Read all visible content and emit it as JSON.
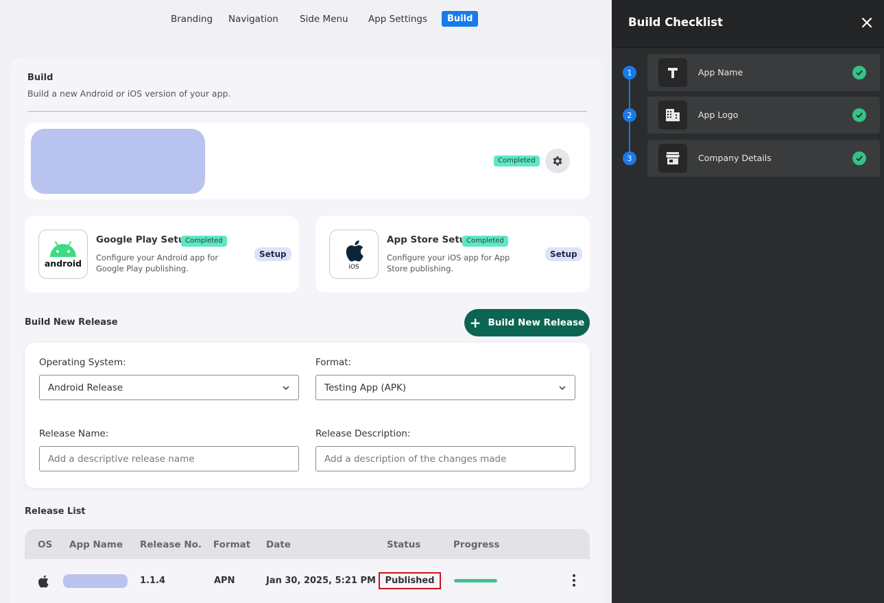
{
  "tabs": [
    {
      "label": "Branding",
      "active": false
    },
    {
      "label": "Navigation",
      "active": false
    },
    {
      "label": "Side Menu",
      "active": false
    },
    {
      "label": "App Settings",
      "active": false
    },
    {
      "label": "Build",
      "active": true
    }
  ],
  "build": {
    "title": "Build",
    "subtitle": "Build a new Android or iOS version of your app.",
    "app_status": "Completed"
  },
  "stores": {
    "google": {
      "icon_label": "android",
      "title": "Google Play Setup",
      "status": "Completed",
      "description": "Configure your Android app for Google Play publishing.",
      "setup_label": "Setup"
    },
    "apple": {
      "icon_label": "iOS",
      "title": "App Store Setup",
      "status": "Completed",
      "description": "Configure your iOS app for App Store publishing.",
      "setup_label": "Setup"
    }
  },
  "new_release": {
    "title": "Build New Release",
    "button_label": "Build New Release",
    "os_label": "Operating System:",
    "os_value": "Android Release",
    "format_label": "Format:",
    "format_value": "Testing App (APK)",
    "name_label": "Release Name:",
    "name_placeholder": "Add a descriptive release name",
    "desc_label": "Release Description:",
    "desc_placeholder": "Add a description of the changes made"
  },
  "release_list": {
    "title": "Release List",
    "columns": [
      "OS",
      "App Name",
      "Release No.",
      "Format",
      "Date",
      "Status",
      "Progress"
    ],
    "rows": [
      {
        "os_icon": "apple-icon",
        "release_no": "1.1.4",
        "format": "APN",
        "date": "Jan 30, 2025, 5:21 PM",
        "status": "Published",
        "progress": 1.0
      }
    ]
  },
  "checklist": {
    "title": "Build Checklist",
    "items": [
      {
        "number": "1",
        "label": "App Name",
        "icon": "text-icon",
        "done": true
      },
      {
        "number": "2",
        "label": "App Logo",
        "icon": "building-icon",
        "done": true
      },
      {
        "number": "3",
        "label": "Company Details",
        "icon": "store-icon",
        "done": true
      }
    ]
  },
  "colors": {
    "accent": "#1a7ae8",
    "primary_button": "#0c6552",
    "completed_badge": "#5fe6c2",
    "success": "#36c187",
    "status_highlight": "#d0101c",
    "placeholder_block": "#b9c3f0"
  }
}
